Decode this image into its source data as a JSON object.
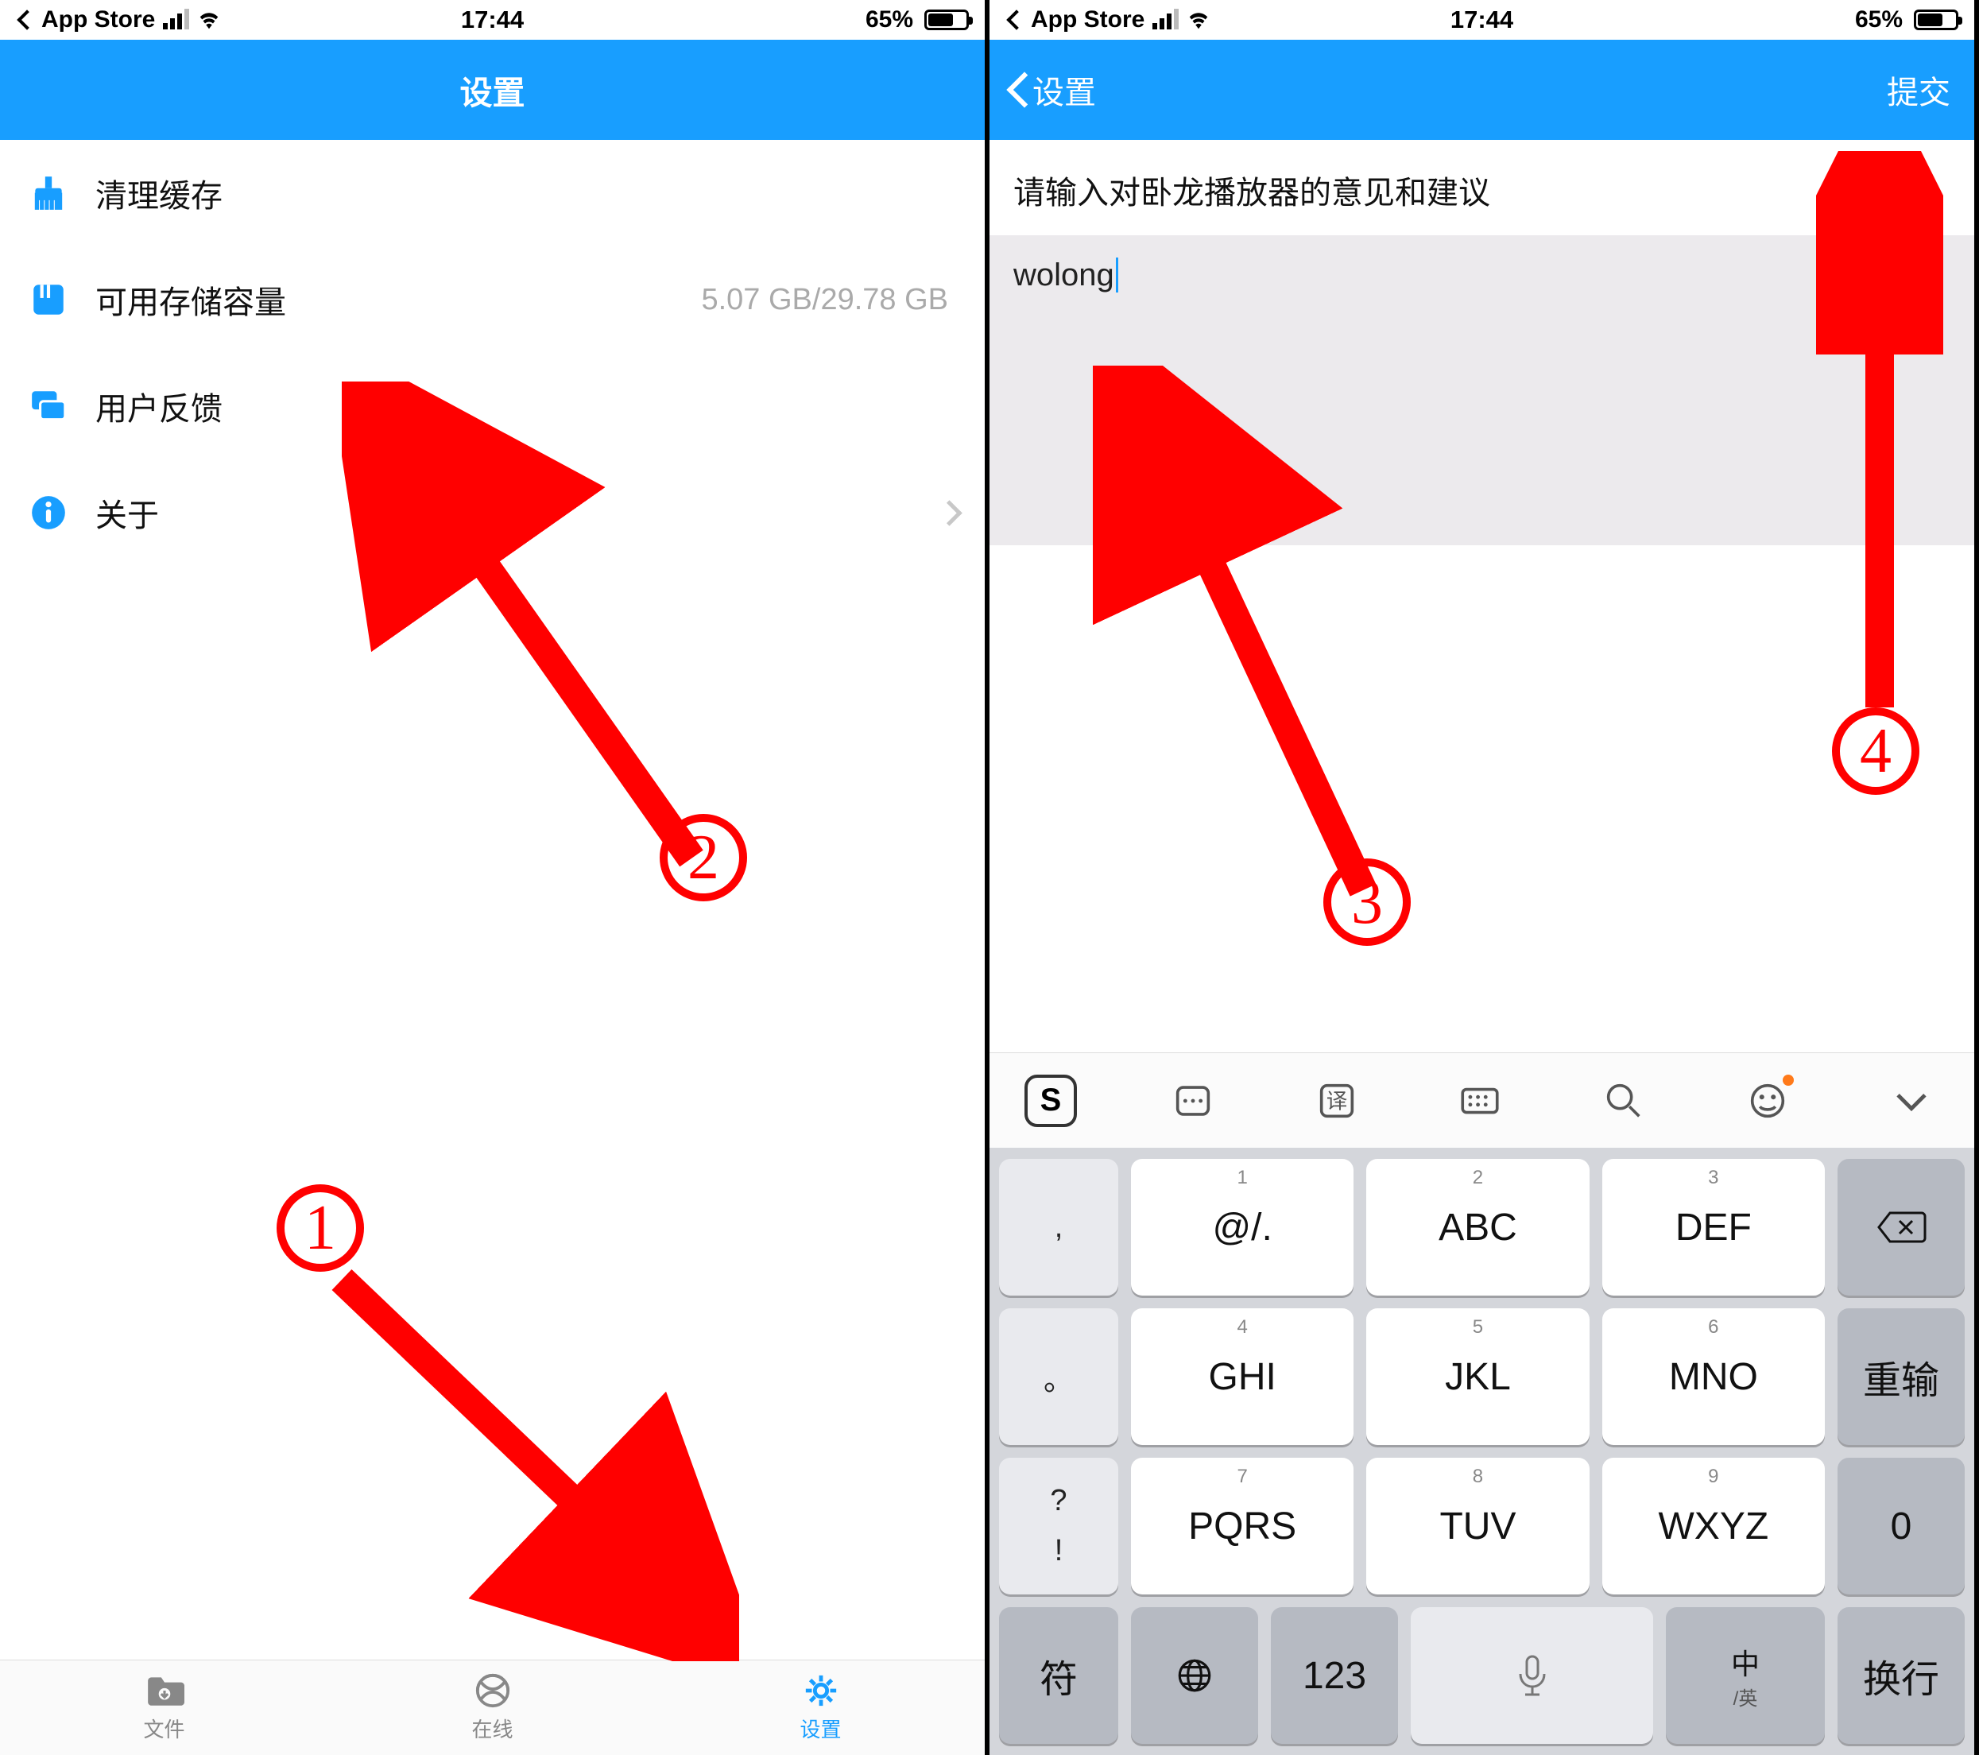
{
  "status": {
    "carrier_back_label": "App Store",
    "time": "17:44",
    "battery_pct": "65%"
  },
  "screen1": {
    "nav_title": "设置",
    "rows": {
      "clear_cache": "清理缓存",
      "storage_label": "可用存储容量",
      "storage_value": "5.07 GB/29.78 GB",
      "feedback": "用户反馈",
      "about": "关于"
    },
    "tabs": {
      "files": "文件",
      "online": "在线",
      "settings": "设置"
    }
  },
  "screen2": {
    "nav_back": "设置",
    "nav_submit": "提交",
    "prompt": "请输入对卧龙播放器的意见和建议",
    "textarea_value": "wolong",
    "keyboard": {
      "side": [
        ",",
        "。",
        "?",
        "!"
      ],
      "keys": [
        {
          "sup": "1",
          "main": "@/."
        },
        {
          "sup": "2",
          "main": "ABC"
        },
        {
          "sup": "3",
          "main": "DEF"
        },
        {
          "sup": "4",
          "main": "GHI"
        },
        {
          "sup": "5",
          "main": "JKL"
        },
        {
          "sup": "6",
          "main": "MNO"
        },
        {
          "sup": "7",
          "main": "PQRS"
        },
        {
          "sup": "8",
          "main": "TUV"
        },
        {
          "sup": "9",
          "main": "WXYZ"
        }
      ],
      "right": [
        "",
        "重输",
        "0"
      ],
      "bottom": {
        "sym": "符",
        "num": "123",
        "lang_main": "中",
        "lang_sub": "/英",
        "enter": "换行"
      }
    }
  },
  "annotations": {
    "n1": "1",
    "n2": "2",
    "n3": "3",
    "n4": "4"
  }
}
